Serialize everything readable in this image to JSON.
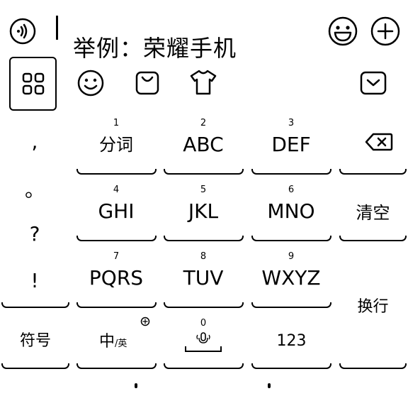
{
  "header": {
    "sample_text": "举例：荣耀手机"
  },
  "left_punctuation": [
    ",",
    "。",
    "?",
    "!"
  ],
  "keys": {
    "k1": {
      "num": "1",
      "label": "分词"
    },
    "k2": {
      "num": "2",
      "label": "ABC"
    },
    "k3": {
      "num": "3",
      "label": "DEF"
    },
    "k4": {
      "num": "4",
      "label": "GHI"
    },
    "k5": {
      "num": "5",
      "label": "JKL"
    },
    "k6": {
      "num": "6",
      "label": "MNO"
    },
    "k7": {
      "num": "7",
      "label": "PQRS"
    },
    "k8": {
      "num": "8",
      "label": "TUV"
    },
    "k9": {
      "num": "9",
      "label": "WXYZ"
    },
    "k0": {
      "num": "0"
    }
  },
  "side_keys": {
    "clear": "清空",
    "newline": "换行"
  },
  "bottom_row": {
    "symbols": "符号",
    "lang_main": "中",
    "lang_alt": "/英",
    "numbers": "123"
  },
  "icons": {
    "voice": "voice-wave-icon",
    "emoji": "emoji-face-icon",
    "plus": "plus-circle-icon",
    "grid": "grid-menu-icon",
    "smile": "smile-icon",
    "bag": "shopping-bag-icon",
    "shirt": "tshirt-icon",
    "collapse": "collapse-keyboard-icon",
    "backspace": "backspace-icon",
    "mic": "microphone-icon"
  }
}
